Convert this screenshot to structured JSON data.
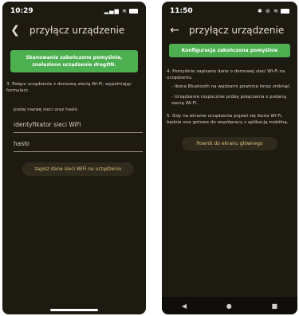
{
  "left": {
    "status": {
      "time": "10:29",
      "icons": "▂▄▆ ≋"
    },
    "header": {
      "title": "przyłącz urządzenie"
    },
    "banner": "Skanowanie zakończone pomyślnie, znaleziono urządzenie dragON.",
    "step3": "3. Połącz urządzenie z domową siecią Wi-Fi, wypełniając formularz.",
    "prompt": "podaj nazwę sieci oraz hasło",
    "ssid_placeholder": "identyfikator sieci WiFi",
    "password_placeholder": "hasło",
    "save_button": "zapisz dane sieci WiFi na urządzeniu"
  },
  "right": {
    "status": {
      "time": "11:50",
      "icons": "✱ ⊘ ≋"
    },
    "header": {
      "title": "przyłącz urządzenie"
    },
    "banner": "Konfiguracja zakończona pomyślnie",
    "step4": "4. Pomyślnie zapisano dane o domowej sieci Wi-Fi na urządzeniu.",
    "bullet1": "- Ikona Bluetooth na wędzarni powinna teraz zniknąć.",
    "bullet2": "- Urządzenie rozpocznie próbę połączenia z podaną siecią Wi-Fi.",
    "step5": "5. Gdy na ekranie urządzenia pojawi się ikona Wi-Fi, będzie one gotowe do współpracy z aplikacją mobilną.",
    "home_button": "Powrót do ekranu głównego",
    "nav": {
      "back": "◀",
      "home": "●",
      "recent": "■"
    }
  },
  "colors": {
    "background": "#1d1a12",
    "banner": "#4caf50",
    "accent": "#d8c27a"
  }
}
